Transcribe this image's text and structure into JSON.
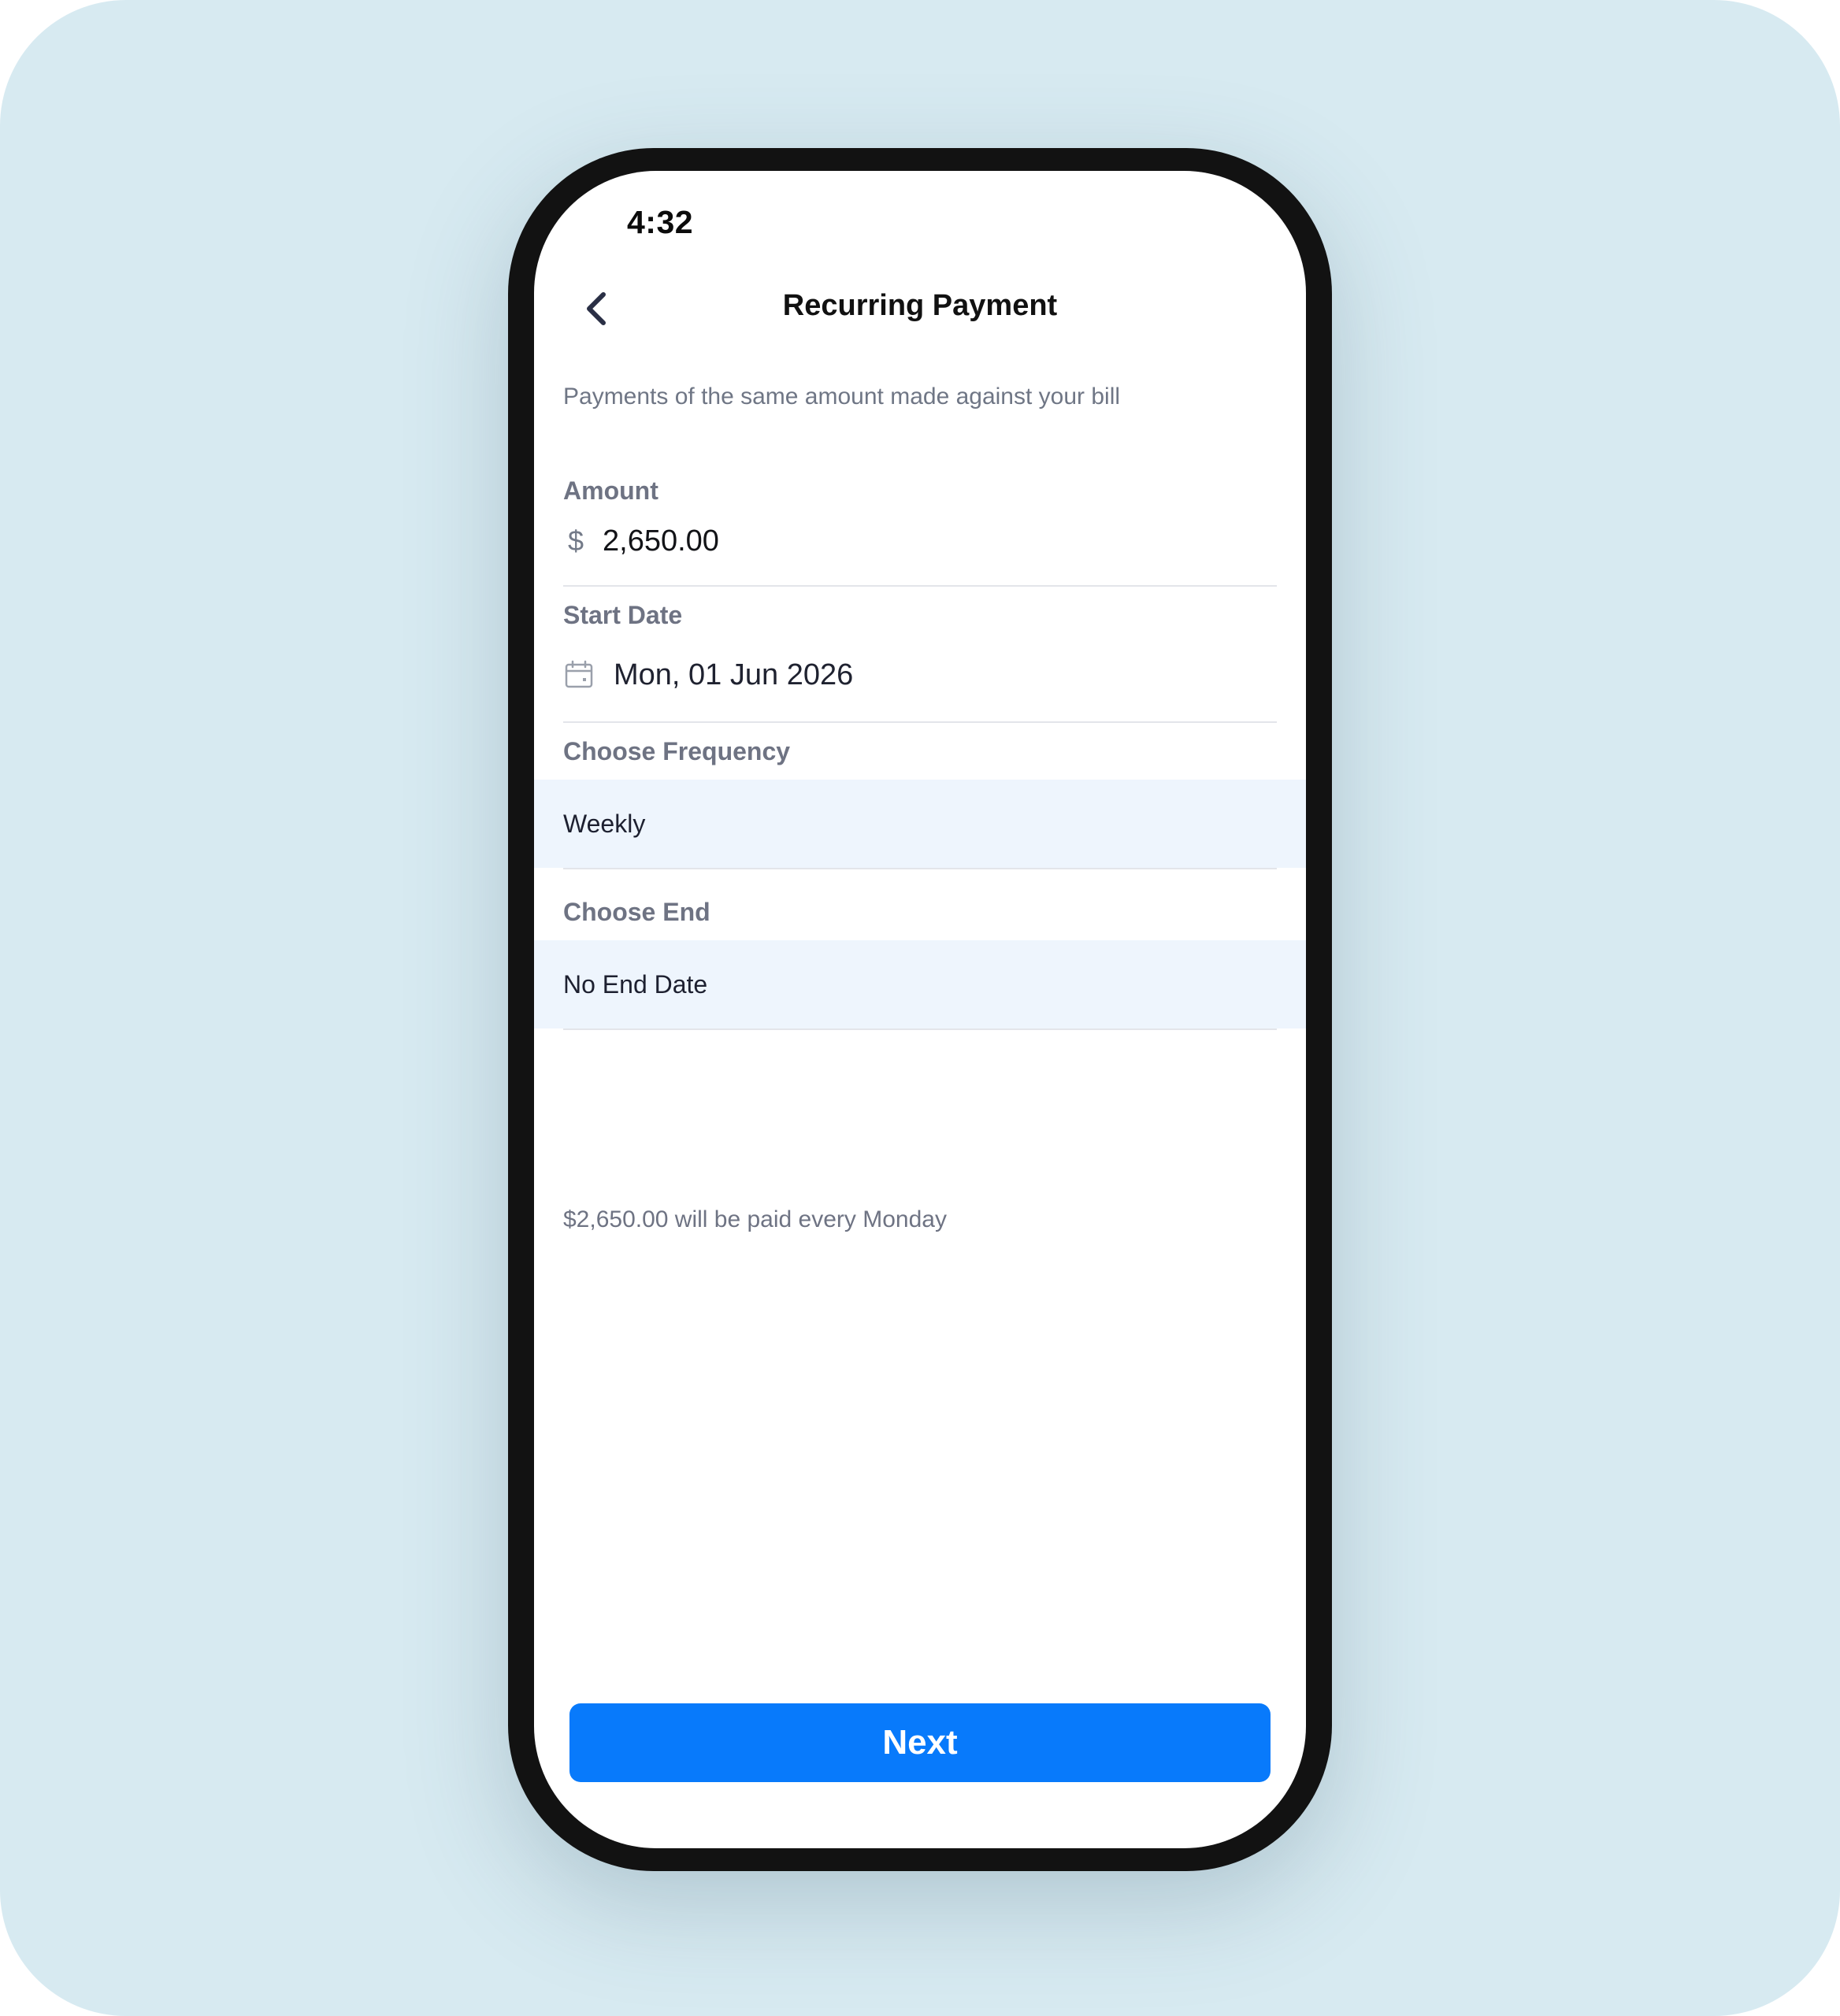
{
  "status_bar": {
    "time": "4:32"
  },
  "header": {
    "back_icon": "chevron-left-icon",
    "title": "Recurring Payment"
  },
  "subtitle": "Payments of the same amount made against your bill",
  "amount": {
    "label": "Amount",
    "currency_symbol": "$",
    "value": "2,650.00"
  },
  "start_date": {
    "label": "Start Date",
    "icon": "calendar-icon",
    "value": "Mon, 01 Jun 2026"
  },
  "frequency": {
    "label": "Choose Frequency",
    "selected": "Weekly"
  },
  "end": {
    "label": "Choose End",
    "selected": "No End Date"
  },
  "summary": "$2,650.00 will be paid every Monday",
  "next_button": {
    "label": "Next"
  },
  "colors": {
    "background": "#d7eaf1",
    "primary": "#087afb",
    "select_highlight": "#eef5fd",
    "label_gray": "#6e7383"
  }
}
